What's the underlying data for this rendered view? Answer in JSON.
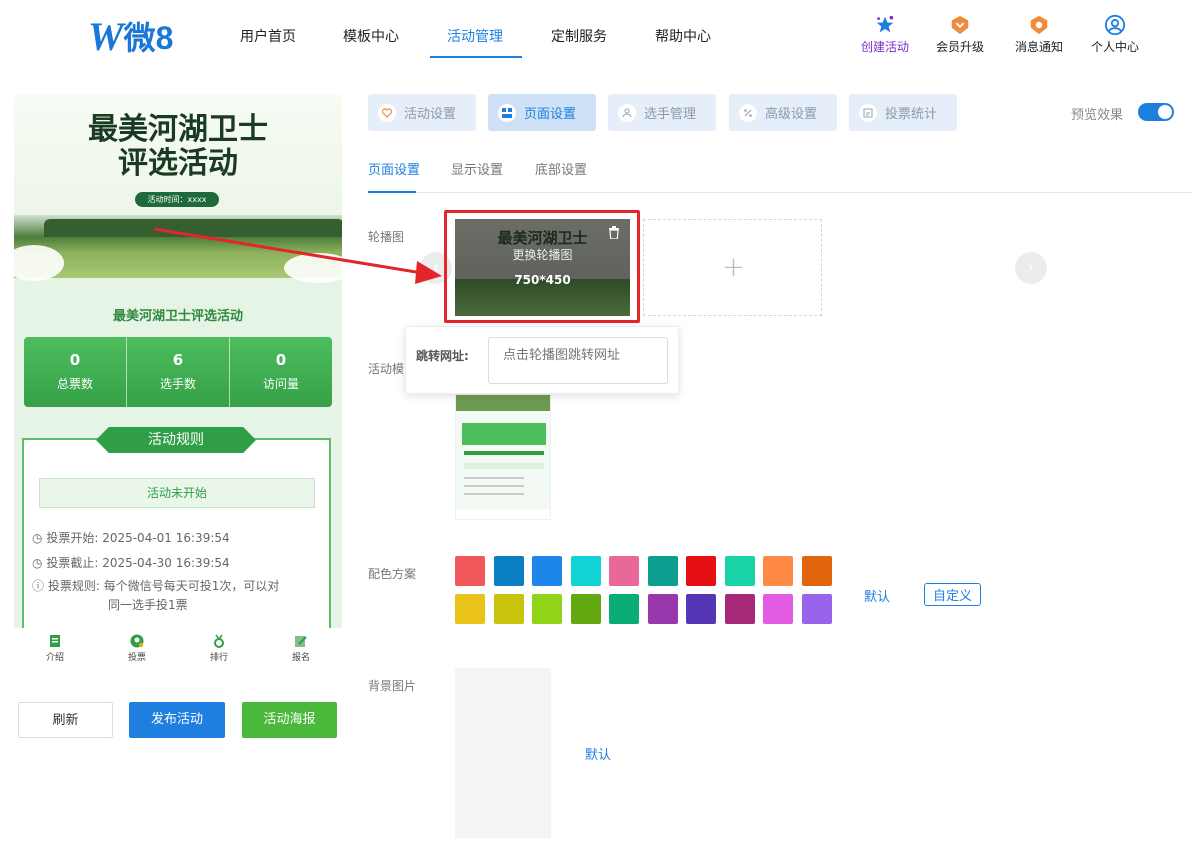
{
  "header": {
    "logo": {
      "mark": "W",
      "text": "微8"
    },
    "nav": [
      "用户首页",
      "模板中心",
      "活动管理",
      "定制服务",
      "帮助中心"
    ],
    "nav_active": "活动管理",
    "actions": [
      {
        "label": "创建活动",
        "icon": "stars-icon",
        "color": "#7a2ec9"
      },
      {
        "label": "会员升级",
        "icon": "vip-badge-icon",
        "color": "#f28a3c"
      },
      {
        "label": "消息通知",
        "icon": "bell-badge-icon",
        "color": "#f28a3c"
      },
      {
        "label": "个人中心",
        "icon": "user-circle-icon",
        "color": "#1e7fe0"
      }
    ]
  },
  "preview": {
    "banner_title_line1": "最美河湖卫士",
    "banner_title_line2": "评选活动",
    "banner_time": "活动时间：xxxx",
    "activity_name": "最美河湖卫士评选活动",
    "stats": [
      {
        "value": "0",
        "label": "总票数"
      },
      {
        "value": "6",
        "label": "选手数"
      },
      {
        "value": "0",
        "label": "访问量"
      }
    ],
    "rules_title": "活动规则",
    "rules_status": "活动未开始",
    "rules": [
      {
        "icon": "clock-icon",
        "label": "投票开始:",
        "value": "2025-04-01 16:39:54"
      },
      {
        "icon": "clock-icon",
        "label": "投票截止:",
        "value": "2025-04-30 16:39:54"
      },
      {
        "icon": "info-icon",
        "label": "投票规则:",
        "value": "每个微信号每天可投1次，可以对",
        "value2": "同一选手投1票"
      }
    ],
    "tabbar": [
      "介绍",
      "投票",
      "排行",
      "报名"
    ],
    "buttons": {
      "refresh": "刷新",
      "publish": "发布活动",
      "poster": "活动海报"
    }
  },
  "editor": {
    "top_tabs": [
      "活动设置",
      "页面设置",
      "选手管理",
      "高级设置",
      "投票统计"
    ],
    "top_tab_active": "页面设置",
    "preview_toggle_label": "预览效果",
    "preview_toggle_on": true,
    "sub_tabs": [
      "页面设置",
      "显示设置",
      "底部设置"
    ],
    "sub_tab_active": "页面设置",
    "carousel_label": "轮播图",
    "carousel_overlay_title": "最美河湖卫士",
    "carousel_overlay_hint": "更换轮播图",
    "carousel_size": "750*450",
    "add_symbol": "+",
    "popover_label": "跳转网址:",
    "popover_placeholder": "点击轮播图跳转网址",
    "template_label": "活动模",
    "color_label": "配色方案",
    "colors_row1": [
      "#f0585c",
      "#0a7fc2",
      "#1e86e8",
      "#12d2d6",
      "#e8689a",
      "#0e9e90",
      "#e60f14",
      "#1ad3a6",
      "#ff8a45",
      "#e0650d"
    ],
    "colors_row2": [
      "#e9c21a",
      "#c8c30c",
      "#8fd416",
      "#62a80e",
      "#0aac78",
      "#9937ad",
      "#5536b5",
      "#a8287a",
      "#e45be3",
      "#9a63ec"
    ],
    "color_default": "默认",
    "color_custom": "自定义",
    "bg_label": "背景图片",
    "bg_default": "默认"
  }
}
